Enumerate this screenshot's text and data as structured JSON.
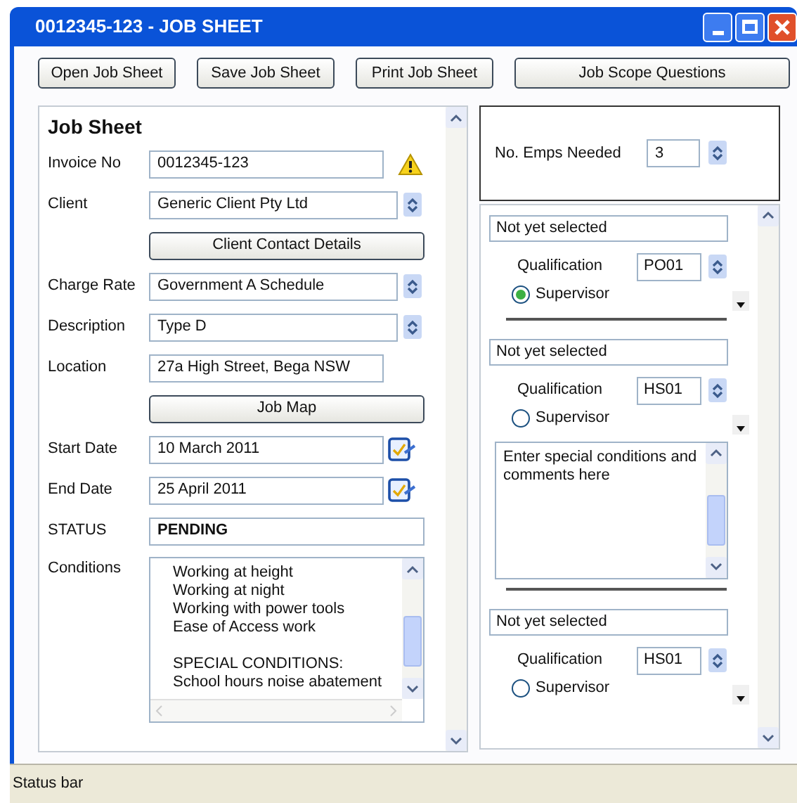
{
  "window": {
    "title": "0012345-123 - JOB SHEET"
  },
  "toolbar": [
    "Open Job Sheet",
    "Save Job Sheet",
    "Print Job Sheet",
    "Job Scope Questions"
  ],
  "job_sheet": {
    "heading": "Job Sheet",
    "fields": [
      {
        "kind": "text",
        "label": "Invoice No",
        "value": "0012345-123",
        "warning": true
      },
      {
        "kind": "combo",
        "label": "Client",
        "value": "Generic Client Pty Ltd"
      },
      {
        "kind": "button",
        "value": "Client Contact Details"
      },
      {
        "kind": "combo",
        "label": "Charge Rate",
        "value": "Government A Schedule"
      },
      {
        "kind": "combo",
        "label": "Description",
        "value": "Type D"
      },
      {
        "kind": "text",
        "label": "Location",
        "value": "27a High Street, Bega NSW"
      },
      {
        "kind": "button",
        "value": "Job Map"
      },
      {
        "kind": "date",
        "label": "Start Date",
        "value": "10 March 2011"
      },
      {
        "kind": "date",
        "label": "End Date",
        "value": "25 April 2011"
      },
      {
        "kind": "status",
        "label": "STATUS",
        "value": "PENDING"
      },
      {
        "kind": "textarea",
        "label": "Conditions",
        "paragraphs": [
          [
            "Working at height",
            "Working at night",
            "Working with power tools",
            "Ease of Access work"
          ],
          [
            "SPECIAL CONDITIONS:",
            "School hours noise abatement"
          ]
        ]
      }
    ]
  },
  "employees_needed": {
    "label": "No. Emps Needed",
    "value": "3"
  },
  "employees": [
    {
      "employee": "Not yet selected",
      "qualification_label": "Qualification",
      "qualification": "PO01",
      "supervisor_label": "Supervisor",
      "selected": true
    },
    {
      "employee": "Not yet selected",
      "qualification_label": "Qualification",
      "qualification": "HS01",
      "supervisor_label": "Supervisor",
      "selected": false,
      "comments": "Enter special conditions and comments here"
    },
    {
      "employee": "Not yet selected",
      "qualification_label": "Qualification",
      "qualification": "HS01",
      "supervisor_label": "Supervisor",
      "selected": false
    }
  ],
  "status_bar": "Status bar"
}
